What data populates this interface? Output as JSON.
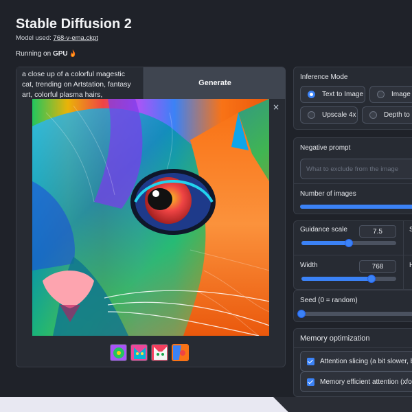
{
  "header": {
    "title": "Stable Diffusion 2",
    "model_prefix": "Model used: ",
    "model_link": "768-v-ema.ckpt",
    "gpu_prefix": "Running on ",
    "gpu_name": "GPU"
  },
  "prompt": {
    "text": "a close up of a colorful magestic cat, trending on Artstation, fantasy art, colorful plasma hairs, conceptual",
    "generate_label": "Generate"
  },
  "gallery": {
    "close_label": "×",
    "thumbnail_count": 4,
    "selected_index": 3
  },
  "inference_mode": {
    "label": "Inference Mode",
    "options": [
      "Text to Image",
      "Image to",
      "Upscale 4x",
      "Depth to Im"
    ],
    "selected": "Text to Image"
  },
  "negative_prompt": {
    "label": "Negative prompt",
    "placeholder": "What to exclude from the image"
  },
  "num_images": {
    "label": "Number of images"
  },
  "guidance": {
    "label": "Guidance scale",
    "value": "7.5",
    "fraction": 0.5,
    "side_label": "S"
  },
  "width": {
    "label": "Width",
    "value": "768",
    "fraction": 0.74,
    "side_label": "H"
  },
  "seed": {
    "label": "Seed (0 = random)",
    "fraction": 0.0
  },
  "memory": {
    "label": "Memory optimization",
    "options": [
      {
        "label": "Attention slicing (a bit slower, bu",
        "checked": true
      },
      {
        "label": "Memory efficient attention (xfor",
        "checked": true
      }
    ]
  },
  "colors": {
    "accent": "#3b82f6",
    "panel": "#272b33",
    "background": "#1f2229",
    "flame": "#f97316"
  }
}
